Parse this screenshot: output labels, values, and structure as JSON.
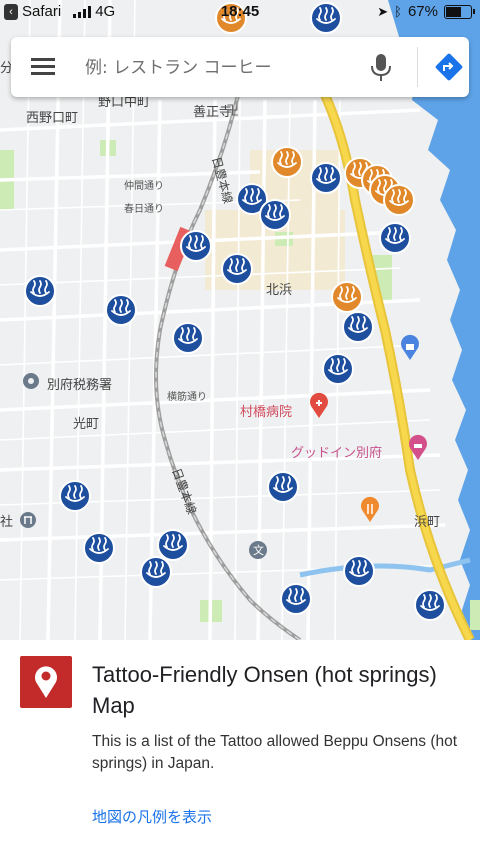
{
  "status_bar": {
    "back_app": "Safari",
    "network": "4G",
    "time": "18:45",
    "battery": "67%",
    "battery_level": 0.67
  },
  "search": {
    "placeholder": "例: レストラン コーヒー"
  },
  "map": {
    "labels": {
      "nishinoguchi_machi": "西野口町",
      "noguchi_naka_machi": "野口中町",
      "zenshoji": "善正寺",
      "nakama_dori": "仲間通り",
      "kasuga_dori": "春日通り",
      "kitahama": "北浜",
      "beppu_tax_office": "別府税務署",
      "yokosuji_dori": "横筋通り",
      "murahashi_hospital": "村橋病院",
      "good_inn_beppu": "グッドイン別府",
      "hikari_machi": "光町",
      "hama_machi": "浜町",
      "nippo_line_north": "日豊本線",
      "nippo_line_south": "日豊本線",
      "edge_left": "分",
      "edge_left_shrine": "社"
    },
    "colors": {
      "land": "#eef0f1",
      "sea": "#5ea3e8",
      "park": "#cdebb5",
      "highway": "#f7d74c",
      "blue_marker": "#1e4e9e",
      "orange_marker": "#e0882a",
      "poi_pink": "#d4508a",
      "poi_red": "#e24b3f"
    },
    "marker_icon": "hot-spring-icon"
  },
  "panel": {
    "title": "Tattoo-Friendly Onsen (hot springs) Map",
    "description": "This is a list of the Tattoo allowed Beppu Onsens (hot springs) in Japan.",
    "legend_link": "地図の凡例を表示"
  }
}
